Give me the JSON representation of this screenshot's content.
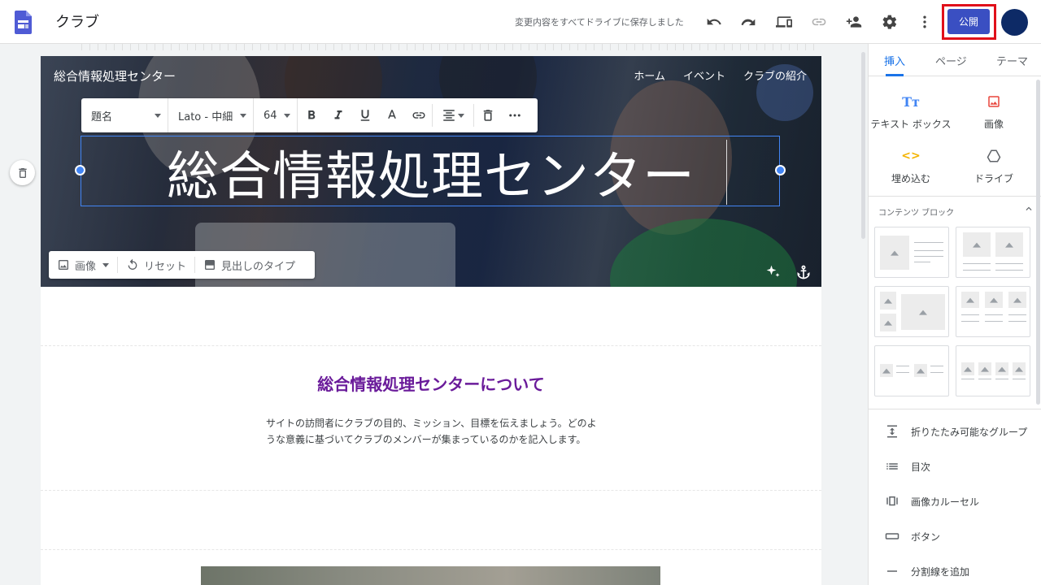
{
  "app": {
    "title": "クラブ",
    "save_status": "変更内容をすべてドライブに保存しました",
    "publish_label": "公開"
  },
  "colors": {
    "accent": "#3a4fc2",
    "highlight": "#e0101a",
    "about_title": "#6a1b9a",
    "tab_active": "#1a73e8"
  },
  "toolbar_icons": [
    "undo-icon",
    "redo-icon",
    "preview-icon",
    "link-icon",
    "share-icon",
    "settings-icon",
    "more-icon"
  ],
  "site": {
    "name": "総合情報処理センター",
    "nav": [
      "ホーム",
      "イベント",
      "クラブの紹介"
    ],
    "hero_title": "総合情報処理センター",
    "about_title": "総合情報処理センターについて",
    "about_body": "サイトの訪問者にクラブの目的、ミッション、目標を伝えましょう。どのような意義に基づいてクラブのメンバーが集まっているのかを記入します。"
  },
  "format_toolbar": {
    "style": "題名",
    "font": "Lato - 中細",
    "size": "64"
  },
  "image_toolbar": {
    "image": "画像",
    "reset": "リセット",
    "header_type": "見出しのタイプ"
  },
  "panel": {
    "tabs": [
      "挿入",
      "ページ",
      "テーマ"
    ],
    "insert": [
      "テキスト ボックス",
      "画像",
      "埋め込む",
      "ドライブ"
    ],
    "content_blocks_heading": "コンテンツ ブロック",
    "list": [
      "折りたたみ可能なグループ",
      "目次",
      "画像カルーセル",
      "ボタン",
      "分割線を追加"
    ]
  }
}
